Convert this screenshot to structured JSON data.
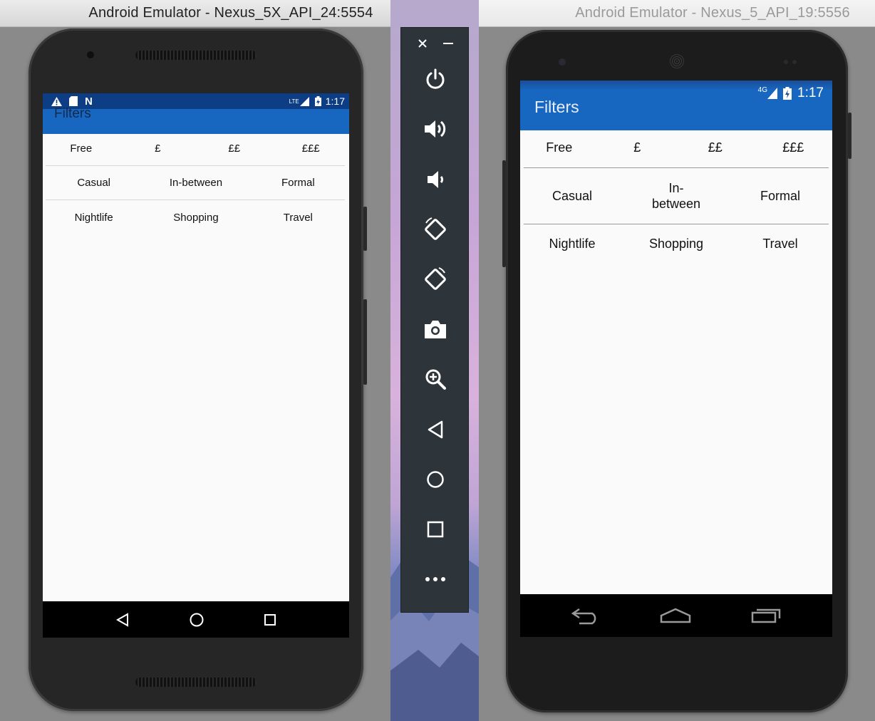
{
  "left_emulator": {
    "window_title": "Android Emulator - Nexus_5X_API_24:5554",
    "status_time": "1:17",
    "status_network": "LTE",
    "app_title": "Filters",
    "rows": [
      [
        "Free",
        "£",
        "££",
        "£££"
      ],
      [
        "Casual",
        "In-between",
        "Formal"
      ],
      [
        "Nightlife",
        "Shopping",
        "Travel"
      ]
    ]
  },
  "right_emulator": {
    "window_title": "Android Emulator - Nexus_5_API_19:5556",
    "status_time": "1:17",
    "status_network": "4G",
    "app_title": "Filters",
    "rows": [
      [
        "Free",
        "£",
        "££",
        "£££"
      ],
      [
        "Casual",
        "In-\nbetween",
        "Formal"
      ],
      [
        "Nightlife",
        "Shopping",
        "Travel"
      ]
    ]
  },
  "toolbar": {
    "buttons": [
      "close-icon",
      "minimize-icon",
      "power-icon",
      "volume-up-icon",
      "volume-down-icon",
      "rotate-left-icon",
      "rotate-right-icon",
      "camera-icon",
      "zoom-icon",
      "back-icon",
      "home-icon",
      "overview-icon",
      "more-icon"
    ]
  },
  "colors": {
    "app_bar": "#1767c1",
    "status_bar_left": "#0d3e85",
    "toolbar_bg": "#2d353b",
    "screen_bg": "#fafafa"
  }
}
